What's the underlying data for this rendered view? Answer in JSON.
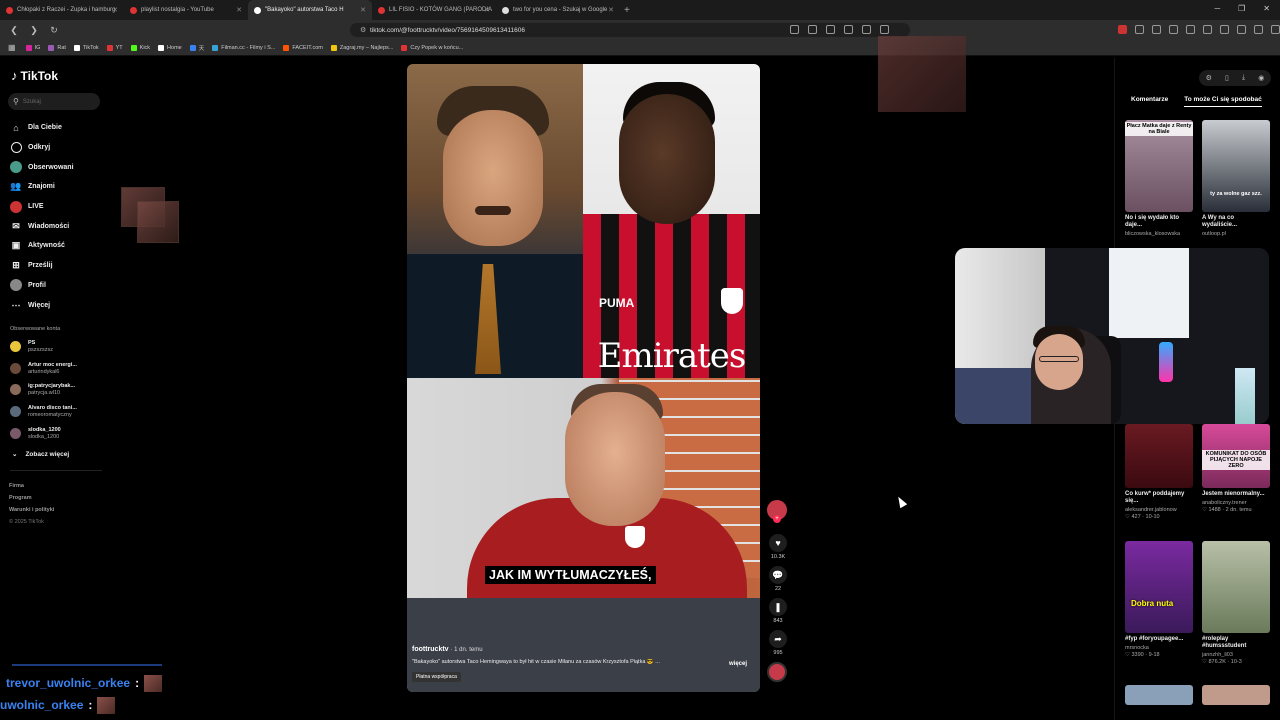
{
  "browser": {
    "tabs": [
      {
        "title": "Chłopaki z Raczei - Zupka i hamburg",
        "fav": "#e03333",
        "active": false
      },
      {
        "title": "playlist nostalgia - YouTube",
        "fav": "#e03333",
        "active": false
      },
      {
        "title": "\"Bakayoko\" autorstwa Taco H",
        "fav": "#ffffff",
        "active": true
      },
      {
        "title": "LIL FISIO - KOTÓW GANG (PARODIA",
        "fav": "#e03333",
        "active": false
      },
      {
        "title": "two for you cena - Szukaj w Google",
        "fav": "#dddddd",
        "active": false
      }
    ],
    "url": "tiktok.com/@foottrucktv/video/7569164509613411606",
    "bookmarks": [
      {
        "label": "IG",
        "color": "#d6249f"
      },
      {
        "label": "Rat",
        "color": "#9b59b6"
      },
      {
        "label": "TikTok",
        "color": "#ffffff"
      },
      {
        "label": "YT",
        "color": "#e03333"
      },
      {
        "label": "Kick",
        "color": "#53fc18"
      },
      {
        "label": "Home",
        "color": "#ffffff"
      },
      {
        "label": "天",
        "color": "#3a82f0"
      },
      {
        "label": "Filman.cc - Filmy i S...",
        "color": "#3aa0d8"
      },
      {
        "label": "FACEIT.com",
        "color": "#ff5500"
      },
      {
        "label": "Zagraj.my – Najleps...",
        "color": "#f1c40f"
      },
      {
        "label": "Czy Popek w końcu...",
        "color": "#e03333"
      }
    ]
  },
  "tiktok": {
    "logo": "TikTok",
    "search_placeholder": "Szukaj",
    "nav": [
      "Dla Ciebie",
      "Odkryj",
      "Obserwowani",
      "Znajomi",
      "LIVE",
      "Wiadomości",
      "Aktywność",
      "Prześlij",
      "Profil",
      "Więcej"
    ],
    "followed_header": "Obserwowane konta",
    "followed": [
      {
        "name": "PS",
        "handle": "pszszszsz"
      },
      {
        "name": "Artur moc energi...",
        "handle": "arturindykal6"
      },
      {
        "name": "ig:patrycjarybak...",
        "handle": "patrycja.wl10"
      },
      {
        "name": "Alvaro disco tani...",
        "handle": "romeoromatyczny"
      },
      {
        "name": "slodka_1200",
        "handle": "slodka_1200"
      }
    ],
    "see_more": "Zobacz więcej",
    "footer_links": [
      "Firma",
      "Program",
      "Warunki i polityki"
    ],
    "copyright": "© 2025 TikTok"
  },
  "video": {
    "caption_text": "JAK IM WYTŁUMACZYŁEŚ,",
    "sponsor_text": "Emirates",
    "brand_text": "PUMA",
    "author": "foottrucktv",
    "time": "· 1 dn. temu",
    "description": "\"Bakayoko\" autorstwa Taco Hemingwaya to był hit w czasie Milanu za czasów Krzysztofa Piątka 😎 ...",
    "more": "więcej",
    "paid": "Płatna współpraca",
    "likes": "10.3K",
    "comments": "22",
    "saves": "843",
    "shares": "995"
  },
  "right_panel": {
    "tab_comments": "Komentarze",
    "tab_related": "To może Ci się spodobać",
    "cards": [
      {
        "title": "No i się wydało kto daje...",
        "user": "bliczowska_klosowska",
        "stats": "",
        "overlay": "Płacz Matka daje z Renty na Biale"
      },
      {
        "title": "A Wy na co wydaliście...",
        "user": "outloop.pl",
        "stats": "",
        "overlay": "ty za wolne gaz szz."
      },
      {
        "title": "Co kurw* poddajemy się...",
        "user": "aleksandrer.jablonow",
        "stats": "♡ 427 · 10-10",
        "overlay": ""
      },
      {
        "title": "Jestem nienormalny...",
        "user": "anaboliczny.trener",
        "stats": "♡ 1488 · 2 dn. temu",
        "overlay": "KOMUNIKAT DO OSÓB PIJĄCYCH NAPOJE ZERO"
      },
      {
        "title": "#fyp #foryoupagee...",
        "user": "mrsnocka",
        "stats": "♡ 3390 · 9-18",
        "overlay": "Dobra nuta"
      },
      {
        "title": "#roleplay #humssstudent",
        "user": "jannzhh_li03",
        "stats": "♡ 876.2K · 10-3",
        "overlay": ""
      }
    ]
  },
  "chat": [
    {
      "user": "trevor_uwolnic_orkee",
      "sep": ":"
    },
    {
      "user": "uwolnic_orkee",
      "sep": ":"
    }
  ]
}
